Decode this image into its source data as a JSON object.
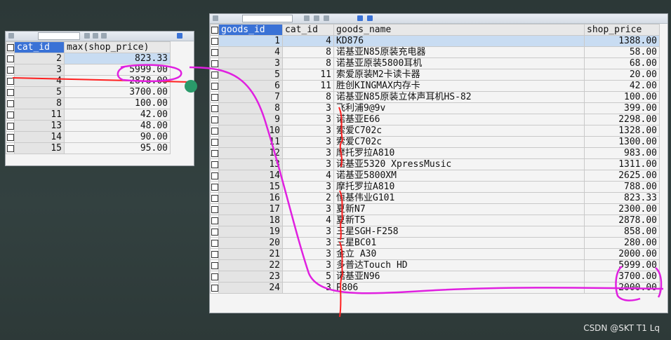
{
  "left_table": {
    "columns": [
      "cat_id",
      "max(shop_price)"
    ],
    "rows": [
      [
        "2",
        "823.33"
      ],
      [
        "3",
        "5999.00"
      ],
      [
        "4",
        "2878.00"
      ],
      [
        "5",
        "3700.00"
      ],
      [
        "8",
        "100.00"
      ],
      [
        "11",
        "42.00"
      ],
      [
        "13",
        "48.00"
      ],
      [
        "14",
        "90.00"
      ],
      [
        "15",
        "95.00"
      ]
    ]
  },
  "right_table": {
    "columns": [
      "goods_id",
      "cat_id",
      "goods_name",
      "shop_price"
    ],
    "rows": [
      [
        "1",
        "4",
        "KD876",
        "1388.00"
      ],
      [
        "4",
        "8",
        "诺基亚N85原装充电器",
        "58.00"
      ],
      [
        "3",
        "8",
        "诺基亚原装5800耳机",
        "68.00"
      ],
      [
        "5",
        "11",
        "索爱原装M2卡读卡器",
        "20.00"
      ],
      [
        "6",
        "11",
        "胜创KINGMAX内存卡",
        "42.00"
      ],
      [
        "7",
        "8",
        "诺基亚N85原装立体声耳机HS-82",
        "100.00"
      ],
      [
        "8",
        "3",
        "飞利浦9@9v",
        "399.00"
      ],
      [
        "9",
        "3",
        "诺基亚E66",
        "2298.00"
      ],
      [
        "10",
        "3",
        "索爱C702c",
        "1328.00"
      ],
      [
        "11",
        "3",
        "索爱C702c",
        "1300.00"
      ],
      [
        "12",
        "3",
        "摩托罗拉A810",
        "983.00"
      ],
      [
        "13",
        "3",
        "诺基亚5320 XpressMusic",
        "1311.00"
      ],
      [
        "14",
        "4",
        "诺基亚5800XM",
        "2625.00"
      ],
      [
        "15",
        "3",
        "摩托罗拉A810",
        "788.00"
      ],
      [
        "16",
        "2",
        "恒基伟业G101",
        "823.33"
      ],
      [
        "17",
        "3",
        "夏新N7",
        "2300.00"
      ],
      [
        "18",
        "4",
        "夏新T5",
        "2878.00"
      ],
      [
        "19",
        "3",
        "三星SGH-F258",
        "858.00"
      ],
      [
        "20",
        "3",
        "三星BC01",
        "280.00"
      ],
      [
        "21",
        "3",
        "金立 A30",
        "2000.00"
      ],
      [
        "22",
        "3",
        "多普达Touch HD",
        "5999.00"
      ],
      [
        "23",
        "5",
        "诺基亚N96",
        "3700.00"
      ],
      [
        "24",
        "3",
        "P806",
        "2000.00"
      ]
    ]
  },
  "watermark": "CSDN @SKT T1 Lq",
  "colors": {
    "annotation_magenta": "#e020e0",
    "annotation_red": "#ff2020",
    "header_selected": "#3a72d6"
  }
}
